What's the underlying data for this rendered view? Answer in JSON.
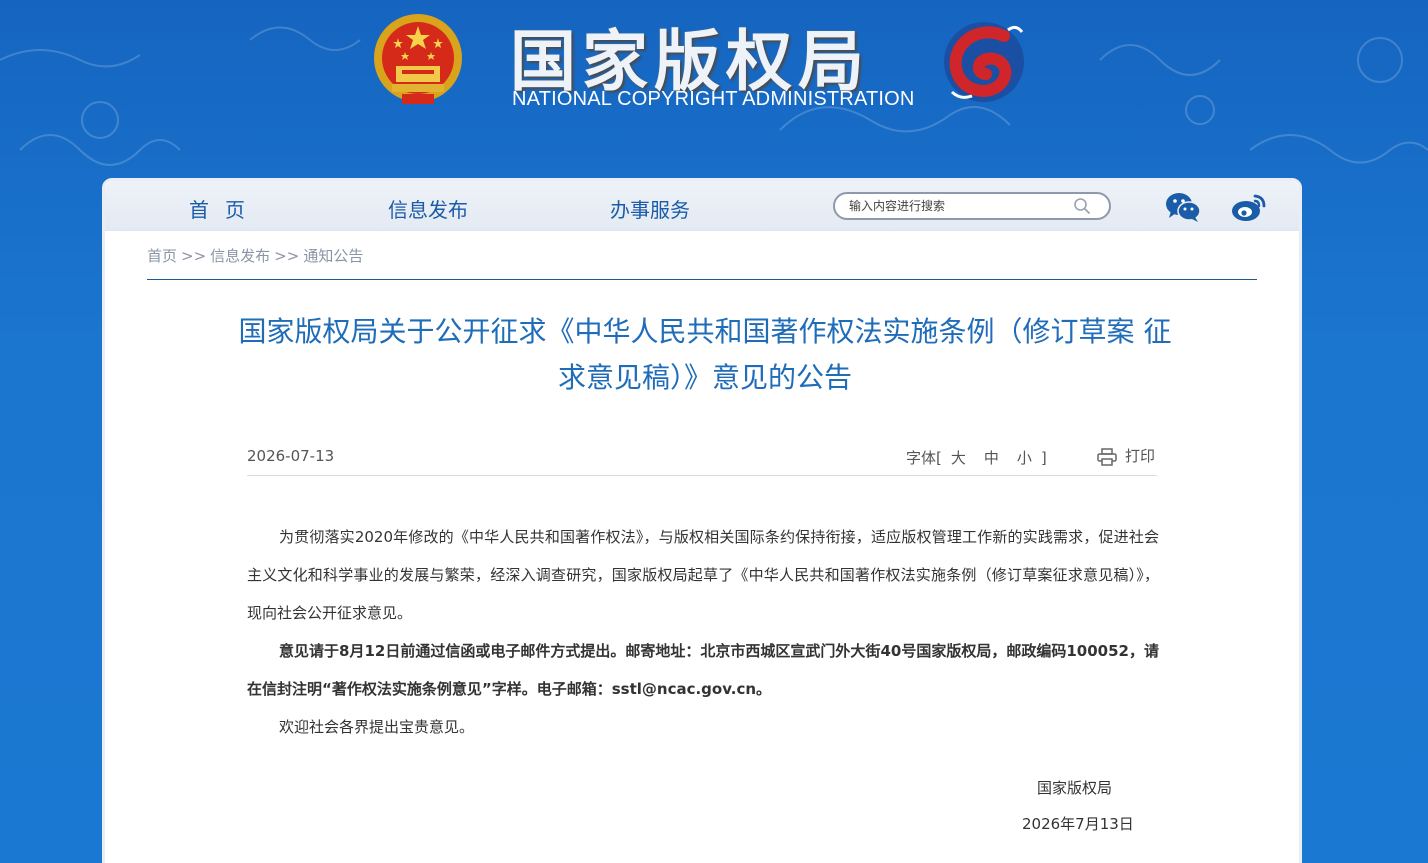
{
  "header": {
    "title": "国家版权局",
    "subtitle": "NATIONAL COPYRIGHT ADMINISTRATION"
  },
  "nav": {
    "home": "首页",
    "info": "信息发布",
    "service": "办事服务"
  },
  "search": {
    "placeholder": "输入内容进行搜索"
  },
  "icons": {
    "search": "search-icon",
    "wechat": "wechat-icon",
    "weibo": "weibo-icon",
    "print": "print-icon",
    "emblem": "national-emblem-icon",
    "logo": "copyright-logo-icon"
  },
  "breadcrumb": {
    "items": [
      "首页",
      "信息发布",
      "通知公告"
    ],
    "separator": ">>"
  },
  "article": {
    "title": "国家版权局关于公开征求《中华人民共和国著作权法实施条例（修订草案 征求意见稿）》意见的公告",
    "date": "2026-07-13",
    "font_label": "字体",
    "font_open": "[",
    "font_close": "]",
    "font_large": "大",
    "font_medium": "中",
    "font_small": "小",
    "print_label": "打印",
    "paragraphs": [
      "为贯彻落实2020年修改的《中华人民共和国著作权法》，与版权相关国际条约保持衔接，适应版权管理工作新的实践需求，促进社会主义文化和科学事业的发展与繁荣，经深入调查研究，国家版权局起草了《中华人民共和国著作权法实施条例（修订草案征求意见稿）》，现向社会公开征求意见。",
      "意见请于8月12日前通过信函或电子邮件方式提出。邮寄地址：北京市西城区宣武门外大街40号国家版权局，邮政编码100052，请在信封注明“著作权法实施条例意见”字样。电子邮箱：sstl@ncac.gov.cn。",
      "欢迎社会各界提出宝贵意见。"
    ],
    "signature": "国家版权局",
    "signature_date": "2026年7月13日"
  },
  "colors": {
    "background": "#1b76cf",
    "nav_text": "#1a5ca8",
    "title_text": "#1f6cb9",
    "body_text": "#333333"
  }
}
